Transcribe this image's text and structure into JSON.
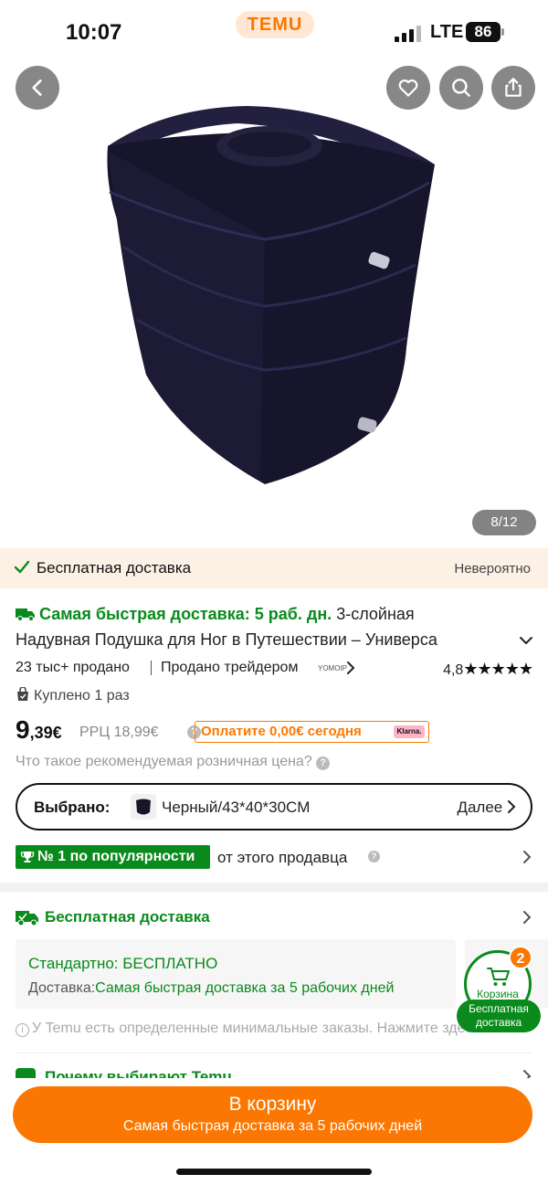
{
  "status_bar": {
    "time": "10:07",
    "app_logo": "TEMU",
    "network": "LTE",
    "battery": "86"
  },
  "hero": {
    "back_icon": "chevron-left-icon",
    "favorite_icon": "heart-icon",
    "search_icon": "search-icon",
    "share_icon": "share-icon",
    "image_counter": "8/12",
    "product_color": "#17152b"
  },
  "banner": {
    "text": "Бесплатная доставка",
    "right": "Невероятно"
  },
  "product": {
    "fast_delivery": "Самая быстрая доставка: 5 раб. дн.",
    "title_line1_rest": " 3-слойная",
    "title_line2": "Надувная Подушка для Ног в Путешествии – Универса",
    "sold": "23 тыс+ продано",
    "seller_prefix": "Продано трейдером",
    "seller_logo": "YOMOIP",
    "rating": "4,8",
    "stars": "★★★★★",
    "bought": "Куплено 1 раз",
    "price_int": "9",
    "price_cents": ",39€",
    "rrp": "РРЦ 18,99€",
    "pay_now": "Оплатите 0,00€ сегодня",
    "klarna": "Klarna.",
    "rrp_question": "Что такое рекомендуемая розничная цена?",
    "selected_label": "Выбрано:",
    "selected_value": "Черный/43*40*30CM",
    "next_label": "Далее",
    "popular_badge": "№ 1 по популярности",
    "popular_text": "от этого продавца"
  },
  "shipping": {
    "title": "Бесплатная доставка",
    "standard": "Стандартно: БЕСПЛАТНО",
    "delivery_prefix": "Доставка:",
    "delivery_value": "Самая быстрая доставка за 5 рабочих дней",
    "min_order": "У Temu есть определенные минимальные заказы. Нажмите здесь",
    "why_title": "Почему выбирают Temu"
  },
  "cart": {
    "count": "2",
    "label": "Корзина",
    "free_line1": "Бесплатная",
    "free_line2": "доставка"
  },
  "cta": {
    "label": "В корзину",
    "sub": "Самая быстрая доставка за 5 рабочих дней"
  },
  "colors": {
    "brand_orange": "#fb7701",
    "green": "#0a8a1c"
  }
}
